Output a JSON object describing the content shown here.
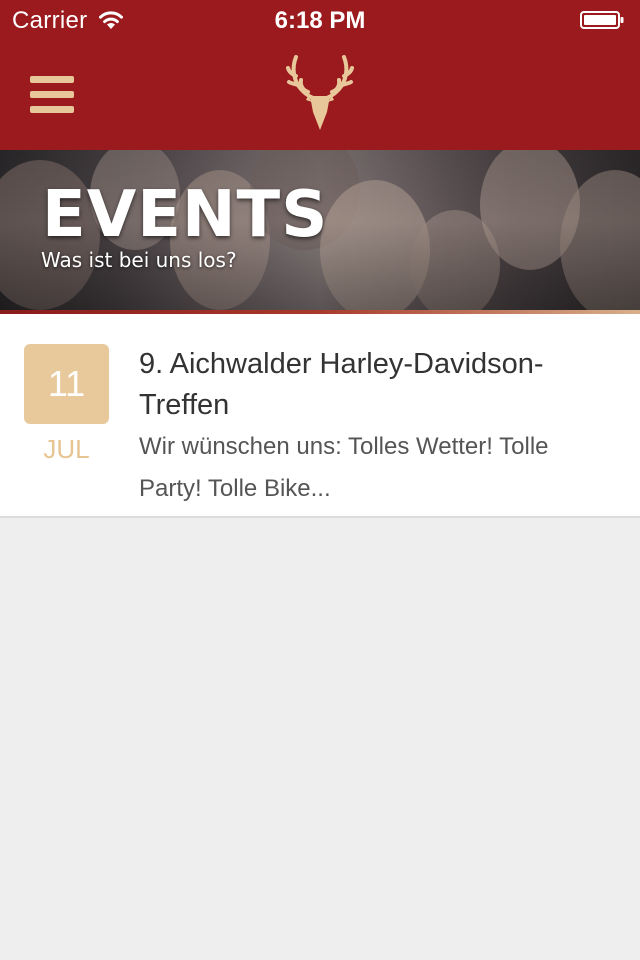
{
  "status_bar": {
    "carrier": "Carrier",
    "time": "6:18 PM",
    "wifi_icon": "wifi-icon",
    "battery_icon": "battery-icon"
  },
  "nav": {
    "menu_icon": "hamburger-menu-icon",
    "logo_icon": "deer-antler-logo-icon",
    "background_color": "#9b1a1d",
    "accent_color": "#e8c79a"
  },
  "hero": {
    "title": "EVENTS",
    "subtitle": "Was ist bei uns los?"
  },
  "events": [
    {
      "day": "11",
      "month": "JUL",
      "title": "9. Aichwalder Harley-Davidson-Treffen",
      "description": "Wir wünschen uns: Tolles Wetter! Tolle Party! Tolle Bike..."
    }
  ]
}
